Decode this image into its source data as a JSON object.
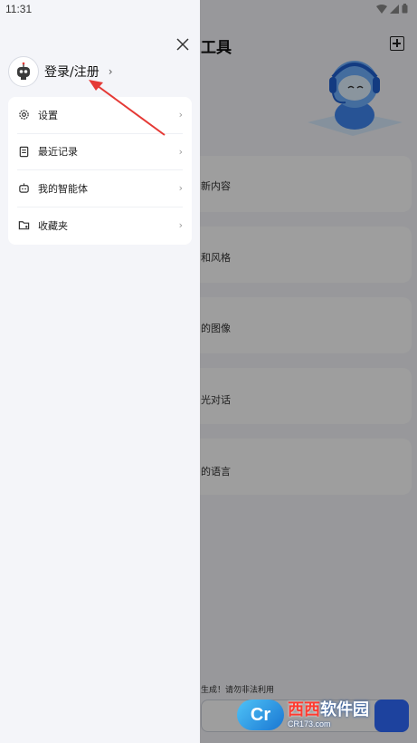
{
  "status_bar": {
    "time": "11:31"
  },
  "background": {
    "title_fragment": "工具",
    "cards": [
      "新内容",
      "和风格",
      "的图像",
      "光对话",
      "的语言"
    ],
    "footer_notice": "生成！请勿非法利用"
  },
  "drawer": {
    "profile": {
      "label": "登录/注册",
      "chevron": "›"
    },
    "menu": [
      {
        "label": "设置",
        "icon": "gear-icon"
      },
      {
        "label": "最近记录",
        "icon": "history-icon"
      },
      {
        "label": "我的智能体",
        "icon": "robot-icon"
      },
      {
        "label": "收藏夹",
        "icon": "folder-star-icon"
      }
    ],
    "chevron": "›"
  },
  "watermark": {
    "logo": "Cr",
    "brand_red": "西西",
    "brand_rest": "软件园",
    "domain": "CR173.com"
  },
  "colors": {
    "scrim": "#000000",
    "annotation_arrow": "#e53935",
    "send_button": "#2f6bff"
  }
}
